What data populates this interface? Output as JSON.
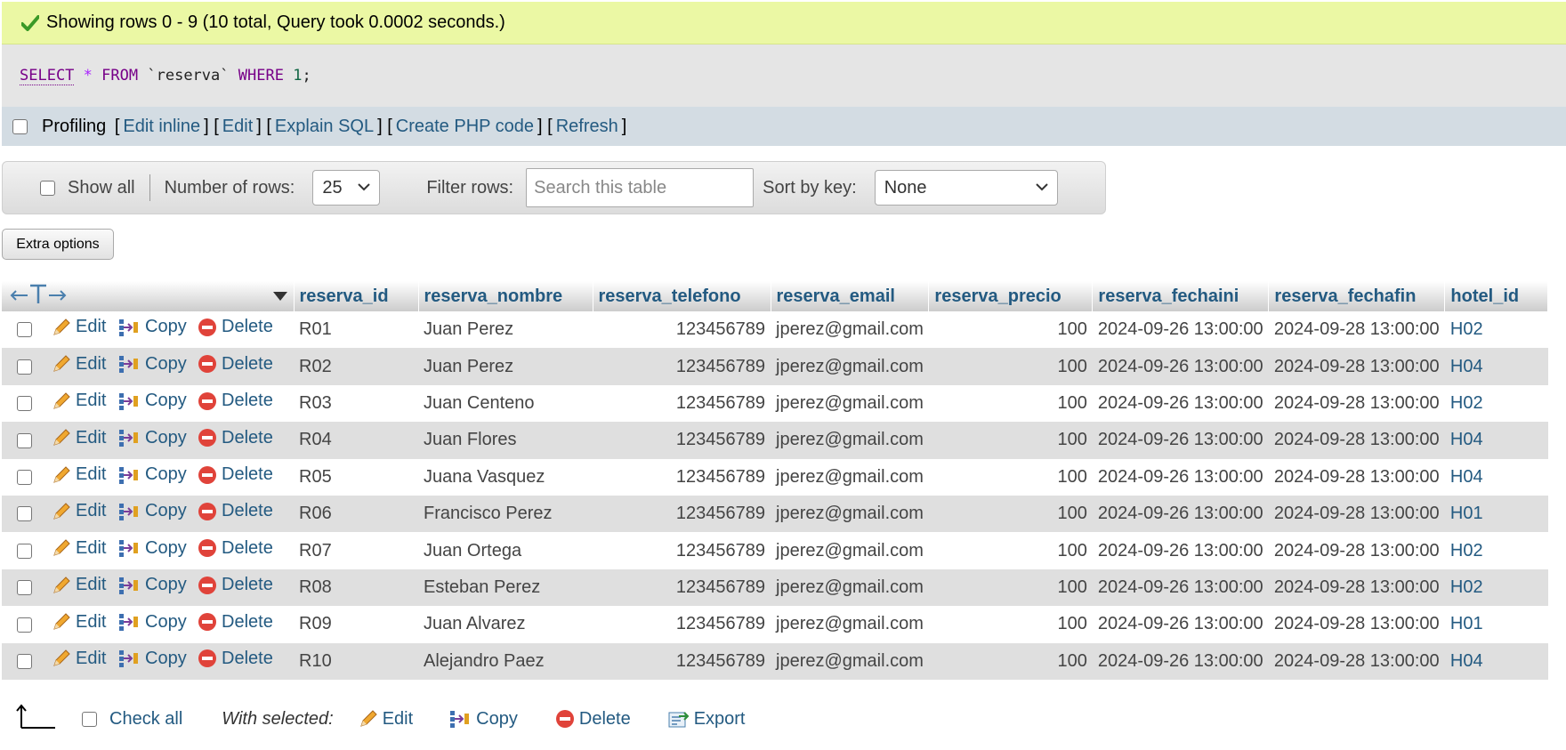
{
  "status": {
    "message": "Showing rows 0 - 9 (10 total, Query took 0.0002 seconds.)"
  },
  "sql": {
    "select": "SELECT",
    "star": "*",
    "from": "FROM",
    "table": "`reserva`",
    "where": "WHERE",
    "value": "1",
    "end": ";"
  },
  "profiling": {
    "label": "Profiling",
    "links": [
      "Edit inline",
      "Edit",
      "Explain SQL",
      "Create PHP code",
      "Refresh"
    ]
  },
  "navbar": {
    "show_all": "Show all",
    "rows_label": "Number of rows:",
    "rows_value": "25",
    "filter_label": "Filter rows:",
    "filter_placeholder": "Search this table",
    "sort_label": "Sort by key:",
    "sort_value": "None"
  },
  "extra_options": "Extra options",
  "table": {
    "columns": [
      "reserva_id",
      "reserva_nombre",
      "reserva_telefono",
      "reserva_email",
      "reserva_precio",
      "reserva_fechaini",
      "reserva_fechafin",
      "hotel_id"
    ],
    "actions": {
      "edit": "Edit",
      "copy": "Copy",
      "delete": "Delete"
    },
    "rows": [
      [
        "R01",
        "Juan Perez",
        "123456789",
        "jperez@gmail.com",
        "100",
        "2024-09-26 13:00:00",
        "2024-09-28 13:00:00",
        "H02"
      ],
      [
        "R02",
        "Juan Perez",
        "123456789",
        "jperez@gmail.com",
        "100",
        "2024-09-26 13:00:00",
        "2024-09-28 13:00:00",
        "H04"
      ],
      [
        "R03",
        "Juan Centeno",
        "123456789",
        "jperez@gmail.com",
        "100",
        "2024-09-26 13:00:00",
        "2024-09-28 13:00:00",
        "H02"
      ],
      [
        "R04",
        "Juan Flores",
        "123456789",
        "jperez@gmail.com",
        "100",
        "2024-09-26 13:00:00",
        "2024-09-28 13:00:00",
        "H04"
      ],
      [
        "R05",
        "Juana Vasquez",
        "123456789",
        "jperez@gmail.com",
        "100",
        "2024-09-26 13:00:00",
        "2024-09-28 13:00:00",
        "H04"
      ],
      [
        "R06",
        "Francisco Perez",
        "123456789",
        "jperez@gmail.com",
        "100",
        "2024-09-26 13:00:00",
        "2024-09-28 13:00:00",
        "H01"
      ],
      [
        "R07",
        "Juan Ortega",
        "123456789",
        "jperez@gmail.com",
        "100",
        "2024-09-26 13:00:00",
        "2024-09-28 13:00:00",
        "H02"
      ],
      [
        "R08",
        "Esteban Perez",
        "123456789",
        "jperez@gmail.com",
        "100",
        "2024-09-26 13:00:00",
        "2024-09-28 13:00:00",
        "H02"
      ],
      [
        "R09",
        "Juan Alvarez",
        "123456789",
        "jperez@gmail.com",
        "100",
        "2024-09-26 13:00:00",
        "2024-09-28 13:00:00",
        "H01"
      ],
      [
        "R10",
        "Alejandro Paez",
        "123456789",
        "jperez@gmail.com",
        "100",
        "2024-09-26 13:00:00",
        "2024-09-28 13:00:00",
        "H04"
      ]
    ]
  },
  "bottom": {
    "check_all": "Check all",
    "with_selected": "With selected:",
    "edit": "Edit",
    "copy": "Copy",
    "delete": "Delete",
    "export": "Export"
  },
  "colors": {
    "success_bg": "#ebf8a4",
    "link": "#235a81",
    "row_even": "#dfdfdf"
  },
  "icons": [
    "check-icon",
    "pencil-icon",
    "copy-icon",
    "delete-icon",
    "export-icon",
    "arrow-left-icon",
    "arrow-right-icon",
    "sort-triangle-icon",
    "select-arrow-icon"
  ]
}
